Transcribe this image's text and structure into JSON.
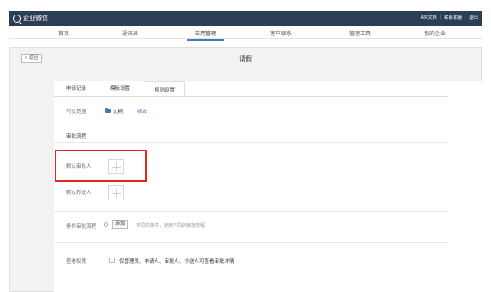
{
  "header": {
    "brand": "企业微信",
    "links": [
      "API文档",
      "联系客服",
      "退出"
    ]
  },
  "nav": {
    "items": [
      "首页",
      "通讯录",
      "应用管理",
      "客户联系",
      "管理工具",
      "我的企业"
    ],
    "active_index": 2
  },
  "page": {
    "back_label": "« 返回",
    "title": "请假"
  },
  "tabs": [
    "申请记录",
    "模板设置",
    "规则设置"
  ],
  "active_tab": 2,
  "visible_range": {
    "label": "可见范围",
    "value": "九桐",
    "edit_label": "修改"
  },
  "approval_flow": {
    "section_title": "审批流程",
    "default_approver_label": "默认审批人",
    "default_cc_label": "默认抄送人",
    "conditional_label": "条件审批流程",
    "add_button": "添加",
    "conditional_hint": "不同的条件，使用不同的审批流程"
  },
  "permission": {
    "label": "查看权限",
    "checkbox_text": "仅管理员、申请人、审批人、抄送人可查看审批详情"
  },
  "colors": {
    "header_bg": "#2b3e55",
    "accent": "#4a76b8",
    "highlight": "#e0281d"
  }
}
